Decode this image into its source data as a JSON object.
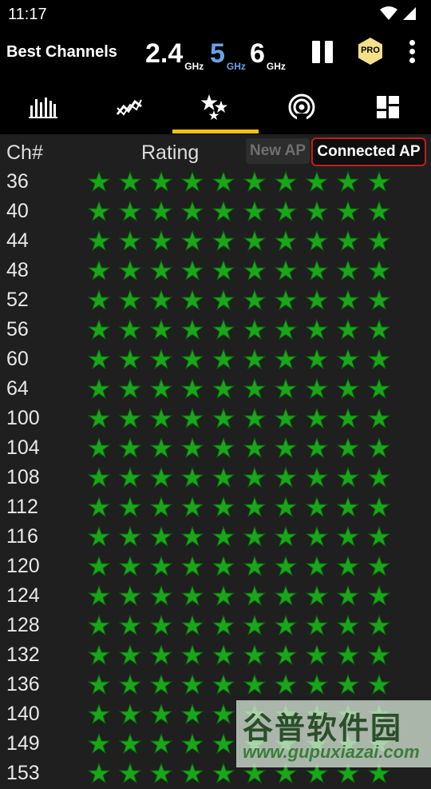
{
  "status_bar": {
    "time": "11:17",
    "icons": [
      "wifi-icon",
      "cell-signal-icon"
    ]
  },
  "app_bar": {
    "title": "Best Channels",
    "bands": [
      {
        "num": "2.4",
        "unit": "GHz",
        "color": "#ffffff",
        "selected": false
      },
      {
        "num": "5",
        "unit": "GHz",
        "color": "#6aa3e6",
        "selected": true
      },
      {
        "num": "6",
        "unit": "GHz",
        "color": "#ffffff",
        "selected": false
      }
    ],
    "pro_label": "PRO"
  },
  "tabs": [
    {
      "icon": "bar-chart-icon"
    },
    {
      "icon": "time-graph-icon"
    },
    {
      "icon": "star-rating-icon",
      "selected": true
    },
    {
      "icon": "ap-signal-icon"
    },
    {
      "icon": "dashboard-icon"
    }
  ],
  "table": {
    "col_channel": "Ch#",
    "col_rating": "Rating",
    "new_ap_label": "New AP",
    "connected_ap_label": "Connected AP",
    "star_color": "#1aa61a",
    "rows": [
      {
        "ch": "36",
        "rating": 10
      },
      {
        "ch": "40",
        "rating": 10
      },
      {
        "ch": "44",
        "rating": 10
      },
      {
        "ch": "48",
        "rating": 10
      },
      {
        "ch": "52",
        "rating": 10
      },
      {
        "ch": "56",
        "rating": 10
      },
      {
        "ch": "60",
        "rating": 10
      },
      {
        "ch": "64",
        "rating": 10
      },
      {
        "ch": "100",
        "rating": 10
      },
      {
        "ch": "104",
        "rating": 10
      },
      {
        "ch": "108",
        "rating": 10
      },
      {
        "ch": "112",
        "rating": 10
      },
      {
        "ch": "116",
        "rating": 10
      },
      {
        "ch": "120",
        "rating": 10
      },
      {
        "ch": "124",
        "rating": 10
      },
      {
        "ch": "128",
        "rating": 10
      },
      {
        "ch": "132",
        "rating": 10
      },
      {
        "ch": "136",
        "rating": 10
      },
      {
        "ch": "140",
        "rating": 10
      },
      {
        "ch": "149",
        "rating": 10
      },
      {
        "ch": "153",
        "rating": 10
      }
    ]
  },
  "watermark": {
    "cn_text": "谷普软件园",
    "url": "www.gupuxiazai.com"
  }
}
